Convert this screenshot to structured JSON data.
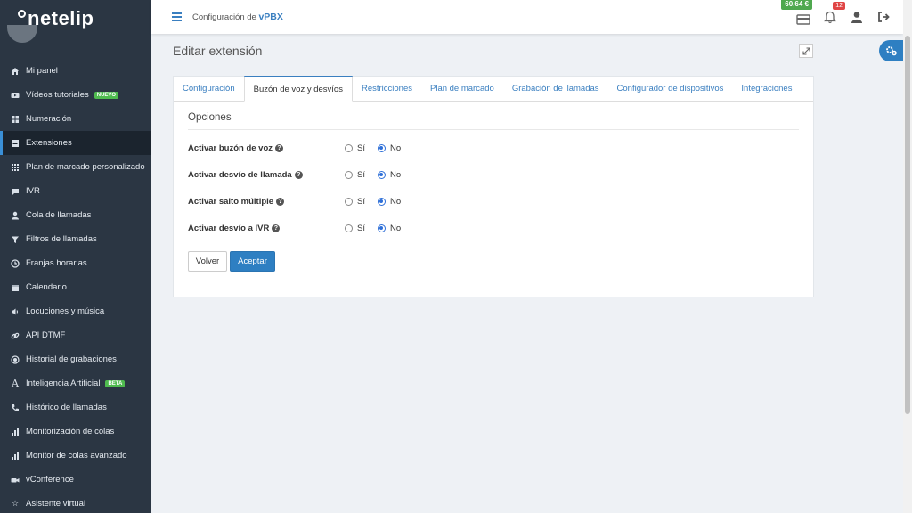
{
  "sidebar": {
    "logo": "netelip",
    "items": [
      {
        "label": "Mi panel",
        "icon": "home-icon"
      },
      {
        "label": "Vídeos tutoriales",
        "icon": "video-icon",
        "badge": "NUEVO"
      },
      {
        "label": "Numeración",
        "icon": "grid-icon"
      },
      {
        "label": "Extensiones",
        "icon": "list-icon",
        "active": true
      },
      {
        "label": "Plan de marcado personalizado",
        "icon": "dialpad-icon"
      },
      {
        "label": "IVR",
        "icon": "chat-icon"
      },
      {
        "label": "Cola de llamadas",
        "icon": "user-icon"
      },
      {
        "label": "Filtros de llamadas",
        "icon": "filter-icon"
      },
      {
        "label": "Franjas horarias",
        "icon": "clock-icon"
      },
      {
        "label": "Calendario",
        "icon": "calendar-icon"
      },
      {
        "label": "Locuciones y música",
        "icon": "volume-icon"
      },
      {
        "label": "API DTMF",
        "icon": "link-icon"
      },
      {
        "label": "Historial de grabaciones",
        "icon": "record-icon"
      },
      {
        "label": "Inteligencia Artificial",
        "icon": "ai-icon",
        "badge": "BETA"
      },
      {
        "label": "Histórico de llamadas",
        "icon": "phone-icon"
      },
      {
        "label": "Monitorización de colas",
        "icon": "bar-chart-icon"
      },
      {
        "label": "Monitor de colas avanzado",
        "icon": "bar-chart-icon"
      },
      {
        "label": "vConference",
        "icon": "camera-icon"
      },
      {
        "label": "Asistente virtual",
        "icon": "star-icon"
      }
    ]
  },
  "header": {
    "title_prefix": "Configuración de ",
    "title_strong": "vPBX",
    "balance": "60,64 €",
    "notifications": "12"
  },
  "page": {
    "title": "Editar extensión",
    "tabs": [
      {
        "label": "Configuración"
      },
      {
        "label": "Buzón de voz y desvíos",
        "active": true
      },
      {
        "label": "Restricciones"
      },
      {
        "label": "Plan de marcado"
      },
      {
        "label": "Grabación de llamadas"
      },
      {
        "label": "Configurador de dispositivos"
      },
      {
        "label": "Integraciones"
      }
    ],
    "section_title": "Opciones",
    "options": [
      {
        "label": "Activar buzón de voz",
        "yes": "Sí",
        "no": "No",
        "selected": "No"
      },
      {
        "label": "Activar desvío de llamada",
        "yes": "Sí",
        "no": "No",
        "selected": "No"
      },
      {
        "label": "Activar salto múltiple",
        "yes": "Sí",
        "no": "No",
        "selected": "No"
      },
      {
        "label": "Activar desvío a IVR",
        "yes": "Sí",
        "no": "No",
        "selected": "No"
      }
    ],
    "back_label": "Volver",
    "accept_label": "Aceptar"
  },
  "colors": {
    "sidebar_bg": "#2b3643",
    "accent": "#2e7fc2",
    "balance_bg": "#4fa84f",
    "badge_green": "#4fbb4f",
    "notification_red": "#e04545"
  }
}
